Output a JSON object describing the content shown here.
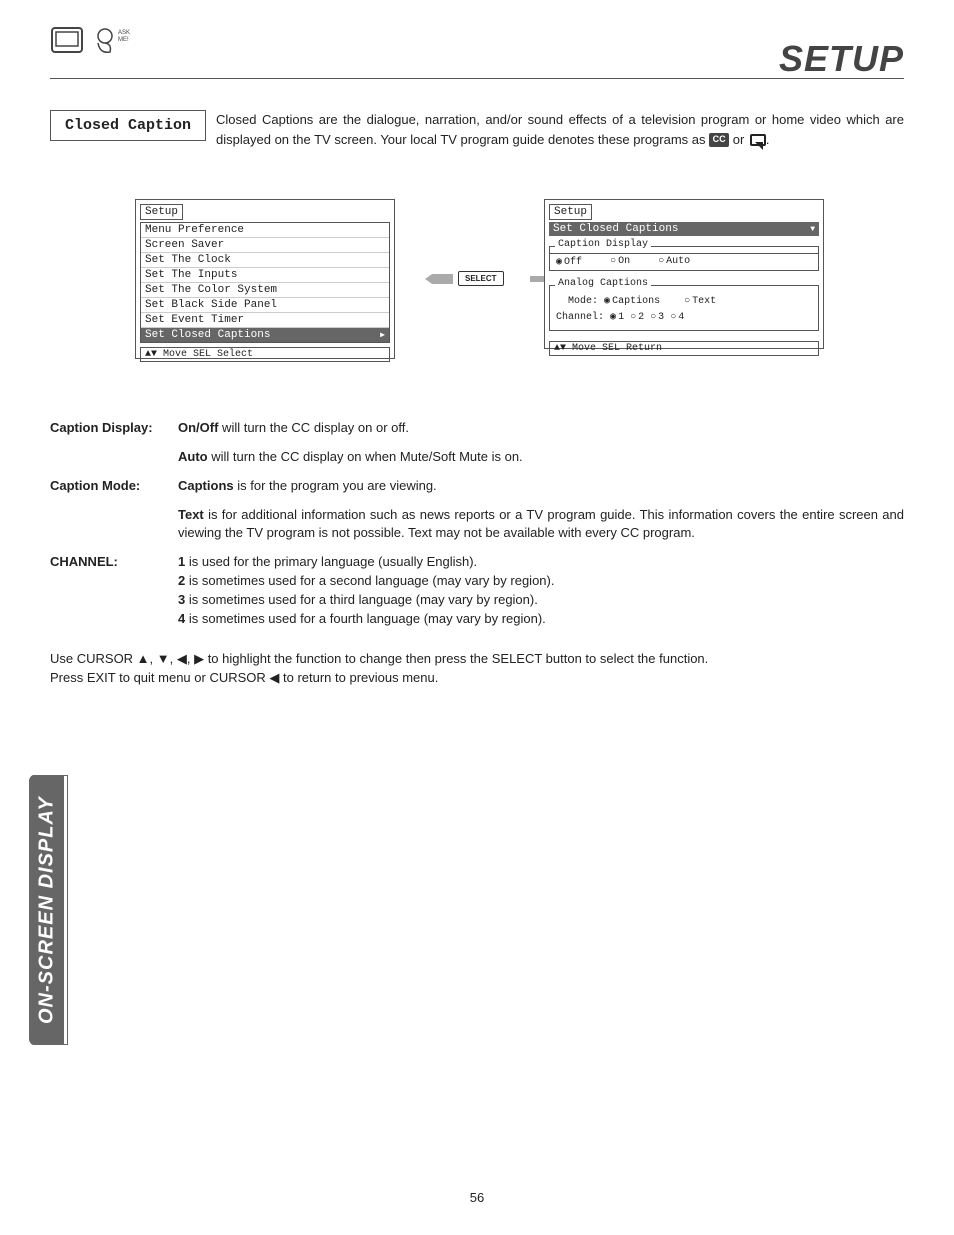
{
  "header": {
    "title": "SETUP",
    "logo_label": "ASK ME!"
  },
  "closed_caption": {
    "box_label": "Closed Caption",
    "desc_part1": "Closed Captions are the dialogue, narration, and/or sound effects of a television program or home video which are displayed on the TV screen.  Your local TV program guide denotes these programs as ",
    "cc_icon": "CC",
    "desc_or": " or ",
    "desc_period": "."
  },
  "osd_left": {
    "title": "Setup",
    "items": [
      "Menu Preference",
      "Screen Saver",
      "Set The Clock",
      "Set The Inputs",
      "Set The Color System",
      "Set Black Side Panel",
      "Set Event Timer"
    ],
    "highlight": "Set Closed Captions",
    "footer": "▲▼ Move  SEL Select"
  },
  "select_label": "SELECT",
  "osd_right": {
    "title": "Setup",
    "highlight": "Set Closed Captions",
    "caption_display_label": "Caption Display",
    "caption_display_opts": [
      "Off",
      "On",
      "Auto"
    ],
    "caption_display_sel": 0,
    "analog_label": "Analog Captions",
    "mode_label": "Mode:",
    "mode_opts": [
      "Captions",
      "Text"
    ],
    "mode_sel": 0,
    "channel_label": "Channel:",
    "channel_opts": [
      "1",
      "2",
      "3",
      "4"
    ],
    "channel_sel": 0,
    "footer": "▲▼ Move  SEL Return"
  },
  "info": {
    "caption_display": {
      "label": "Caption Display:",
      "onoff_b": "On/Off",
      "onoff_t": " will turn the ",
      "onoff_t2": " display on or off.",
      "auto_b": "Auto",
      "auto_t": " will turn the ",
      "auto_t2": " display on when Mute/Soft Mute is on."
    },
    "caption_mode": {
      "label": "Caption Mode:",
      "cap_b": "Captions",
      "cap_t": " is for the program you are viewing.",
      "text_b": "Text",
      "text_t": " is for additional information such as news reports or a TV program guide.  This information covers the entire screen and viewing the TV program is not possible.  Text may not be available with every ",
      "text_t2": " program."
    },
    "channel": {
      "label": "CHANNEL:",
      "r1b": "1",
      "r1t": " is used for the primary language (usually English).",
      "r2b": "2",
      "r2t": " is sometimes used for a second language (may vary by region).",
      "r3b": "3",
      "r3t": " is sometimes used for a third language (may vary by region).",
      "r4b": "4",
      "r4t": " is sometimes used for a fourth language (may vary by region)."
    },
    "nav1": "Use CURSOR ▲, ▼, ◀, ▶ to highlight the function to change then press the SELECT button to select the function.",
    "nav2": "Press EXIT to quit menu or CURSOR ◀ to return to previous menu."
  },
  "side_tab": "ON-SCREEN DISPLAY",
  "page_number": "56"
}
